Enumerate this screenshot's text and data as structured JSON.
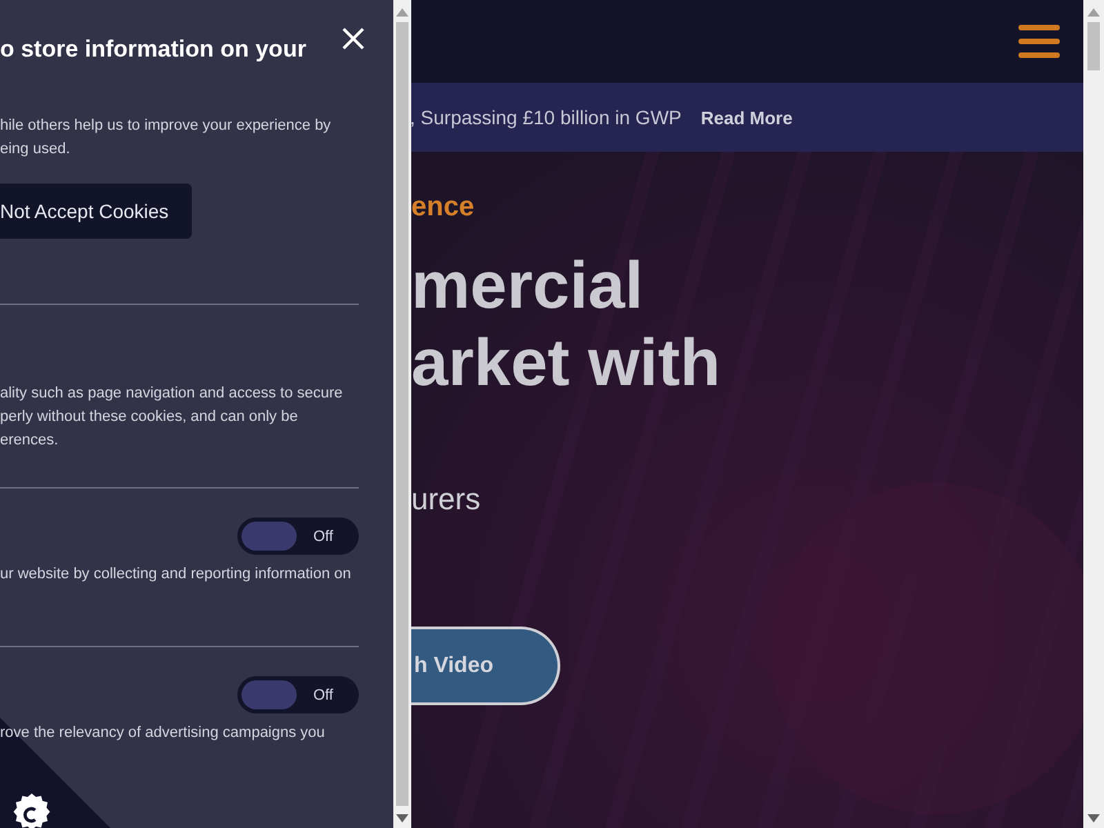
{
  "cookie_panel": {
    "title": "o store information on your",
    "intro_lines": [
      "hile others help us to improve your experience by",
      "eing used."
    ],
    "reject_button": "Not Accept Cookies",
    "sections": [
      {
        "kind": "text",
        "lines": [
          "ality such as page navigation and access to secure",
          "perly without these cookies, and can only be",
          "erences."
        ]
      },
      {
        "kind": "toggle",
        "on": false,
        "state_label": "Off",
        "lines": [
          "ur website by collecting and reporting information on"
        ]
      },
      {
        "kind": "toggle",
        "on": false,
        "state_label": "Off",
        "lines": [
          "rove the relevancy of advertising campaigns you"
        ]
      }
    ]
  },
  "announcement": {
    "text": ", Surpassing £10 billion in GWP",
    "link": "Read More"
  },
  "hero": {
    "eyebrow": "ence",
    "heading_lines": [
      "mercial",
      "arket with"
    ],
    "subtitle": "urers",
    "video_button": "h Video"
  }
}
